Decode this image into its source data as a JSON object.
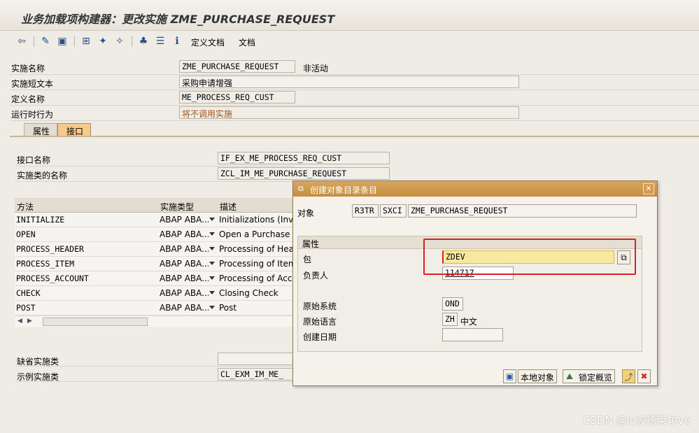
{
  "window": {
    "title": "业务加载项构建器：更改实施 ZME_PURCHASE_REQUEST"
  },
  "toolbar": {
    "define_doc": "定义文档",
    "doc": "文档"
  },
  "header": {
    "impl_name_label": "实施名称",
    "impl_name_value": "ZME_PURCHASE_REQUEST",
    "impl_status": "非活动",
    "short_text_label": "实施短文本",
    "short_text_value": "采购申请增强",
    "def_name_label": "定义名称",
    "def_name_value": "ME_PROCESS_REQ_CUST",
    "runtime_label": "运行时行为",
    "runtime_value": "将不调用实施"
  },
  "tabs": [
    {
      "label": "属性"
    },
    {
      "label": "接口"
    }
  ],
  "interface": {
    "name_label": "接口名称",
    "name_value": "IF_EX_ME_PROCESS_REQ_CUST",
    "class_label": "实施类的名称",
    "class_value": "ZCL_IM_ME_PURCHASE_REQUEST"
  },
  "methods_table": {
    "headers": [
      "方法",
      "实施类型",
      "描述"
    ],
    "rows": [
      {
        "method": "INITIALIZE",
        "type": "ABAP ABA...",
        "desc": "Initializations (Invok"
      },
      {
        "method": "OPEN",
        "type": "ABAP ABA...",
        "desc": "Open a Purchase Re"
      },
      {
        "method": "PROCESS_HEADER",
        "type": "ABAP ABA...",
        "desc": "Processing of Heade"
      },
      {
        "method": "PROCESS_ITEM",
        "type": "ABAP ABA...",
        "desc": "Processing of Item"
      },
      {
        "method": "PROCESS_ACCOUNT",
        "type": "ABAP ABA...",
        "desc": "Processing of Accou"
      },
      {
        "method": "CHECK",
        "type": "ABAP ABA...",
        "desc": "Closing Check"
      },
      {
        "method": "POST",
        "type": "ABAP ABA...",
        "desc": "Post"
      }
    ]
  },
  "bottom": {
    "default_class_label": "缺省实施类",
    "default_class_value": "",
    "example_class_label": "示例实施类",
    "example_class_value": "CL_EXM_IM_ME_"
  },
  "dialog": {
    "title": "创建对象目录条目",
    "object_label": "对象",
    "object_pgmid": "R3TR",
    "object_type": "SXCI",
    "object_name": "ZME_PURCHASE_REQUEST",
    "group_label": "属性",
    "package_label": "包",
    "package_value": "ZDEV",
    "owner_label": "负责人",
    "owner_value": "114717",
    "orig_system_label": "原始系统",
    "orig_system_value": "OND",
    "orig_lang_label": "原始语言",
    "orig_lang_value": "ZH",
    "orig_lang_text": "中文",
    "created_label": "创建日期",
    "created_value": "",
    "btn_local": "本地对象",
    "btn_lock": "锁定概览"
  },
  "watermark": "CSDN @lo波德莱尔ve",
  "colors": {
    "highlight": "#e02020",
    "active_tab": "#f6c98e",
    "dialog_title": "#c58d3e",
    "package_bg": "#f7e9a0"
  }
}
